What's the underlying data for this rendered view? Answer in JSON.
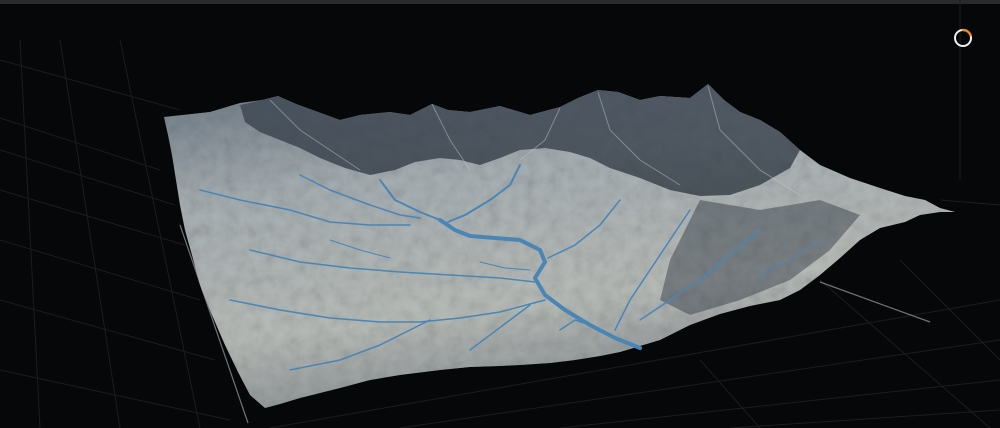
{
  "viewport": {
    "name": "terrain-3d-viewport",
    "background": "#060708",
    "grid_color": "#1b1d20",
    "grid_accent_color": "#8c8f93"
  },
  "terrain": {
    "description_icon": "terrain-mesh",
    "rock_color": "#9aa3a8",
    "shadow_color": "#2b3440",
    "river_color": "#4a86b5"
  },
  "status_indicator": {
    "icon": "loading-ring-icon",
    "ring_color": "#f0f0f0",
    "accent_color": "#f08a1c"
  }
}
